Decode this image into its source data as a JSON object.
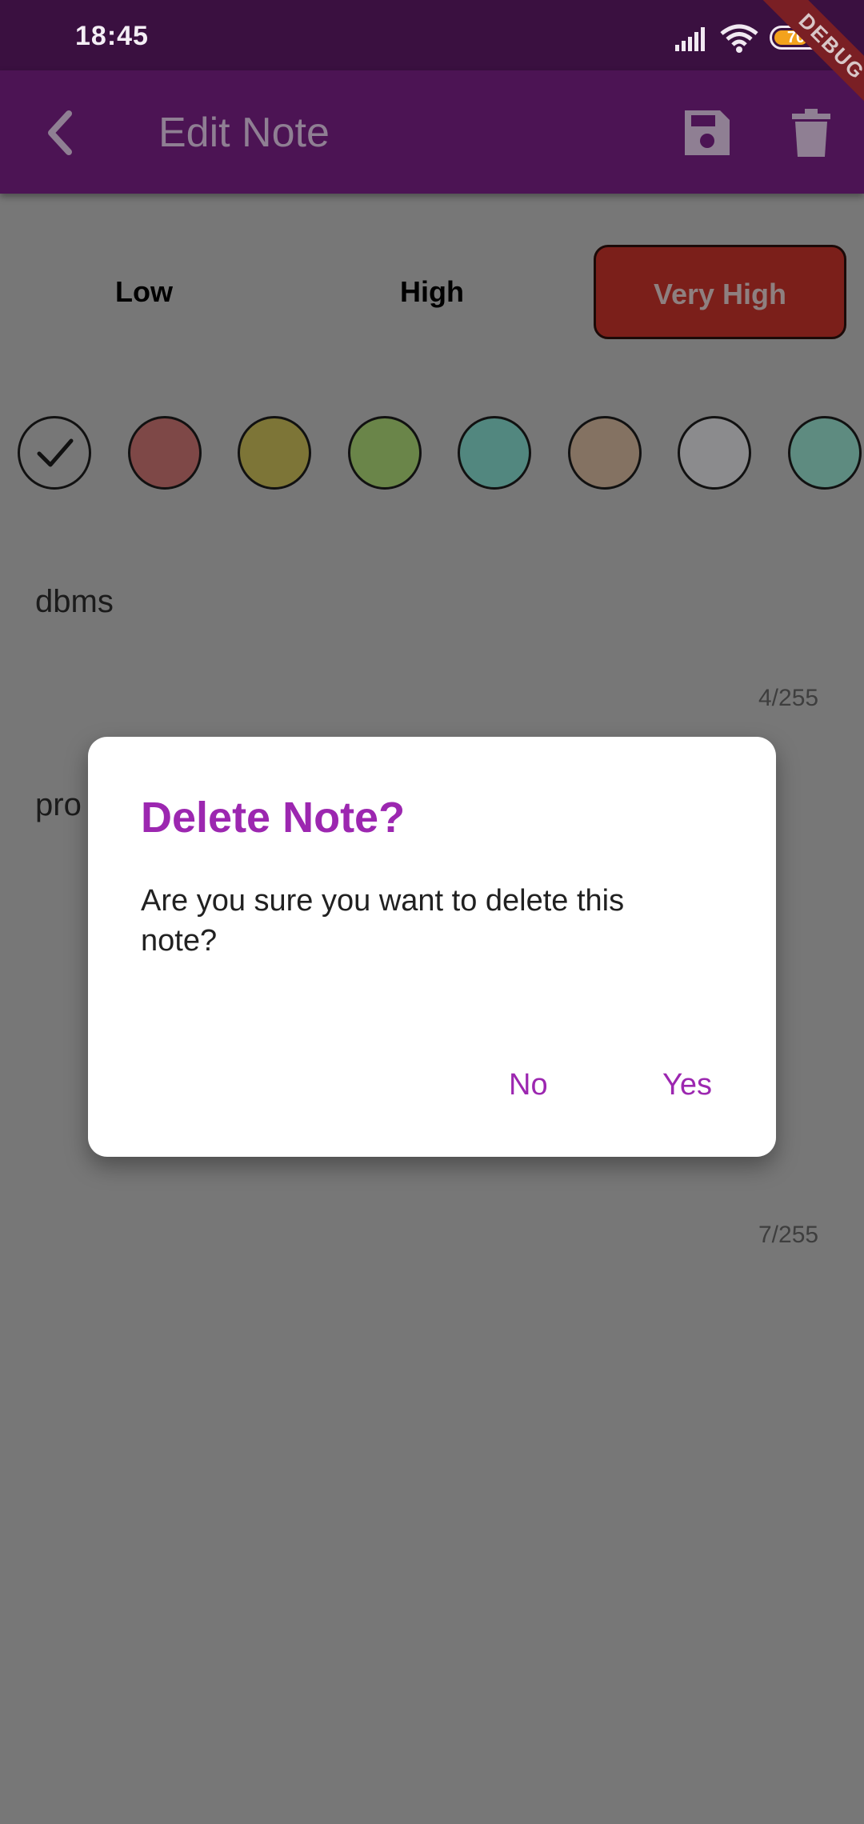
{
  "status_bar": {
    "time": "18:45",
    "battery_level": "70",
    "icons": [
      "signal-icon",
      "wifi-icon",
      "battery-icon"
    ]
  },
  "debug_banner": {
    "label": "DEBUG"
  },
  "app_bar": {
    "title": "Edit Note",
    "icons": {
      "back": "back-arrow-icon",
      "save": "save-icon",
      "delete": "trash-icon"
    }
  },
  "priority": {
    "options": [
      "Low",
      "High",
      "Very High"
    ],
    "selected": "Very High"
  },
  "colors": {
    "swatches": [
      "#777777",
      "#7e4847",
      "#7d7537",
      "#6a8549",
      "#52877f",
      "#847262",
      "#8b8b8d",
      "#5e8b80"
    ],
    "selected_index": 0
  },
  "note": {
    "title": "dbms",
    "title_counter": "4/255",
    "description": "pro",
    "description_counter": "7/255"
  },
  "dialog": {
    "title": "Delete Note?",
    "message": "Are you sure you want to delete this note?",
    "buttons": {
      "no": "No",
      "yes": "Yes"
    },
    "accent_color": "#9c27b0"
  }
}
